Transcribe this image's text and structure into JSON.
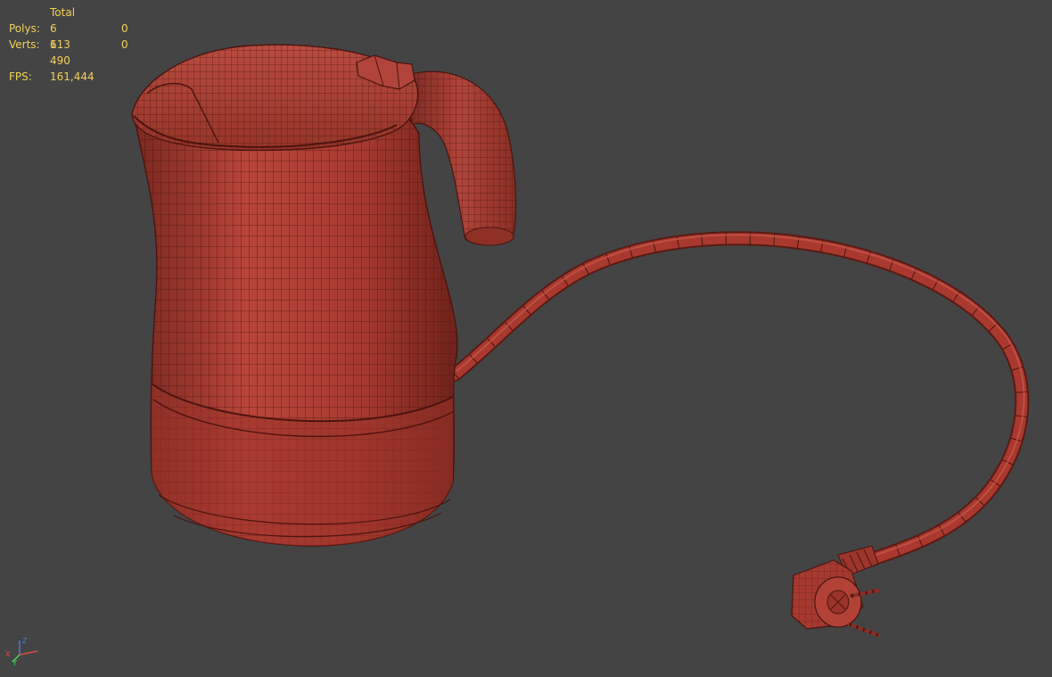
{
  "stats": {
    "header": "Total",
    "polys_label": "Polys:",
    "polys_total": "6 113",
    "polys_selected": "0",
    "verts_label": "Verts:",
    "verts_total": "6 490",
    "verts_selected": "0",
    "fps_label": "FPS:",
    "fps_value": "161,444"
  },
  "gizmo": {
    "x": "X",
    "y": "Y",
    "z": "Z"
  },
  "colors": {
    "background": "#444444",
    "mesh_fill": "#a83a30",
    "mesh_wire": "#4a140f",
    "stats_text": "#f0d15a"
  }
}
